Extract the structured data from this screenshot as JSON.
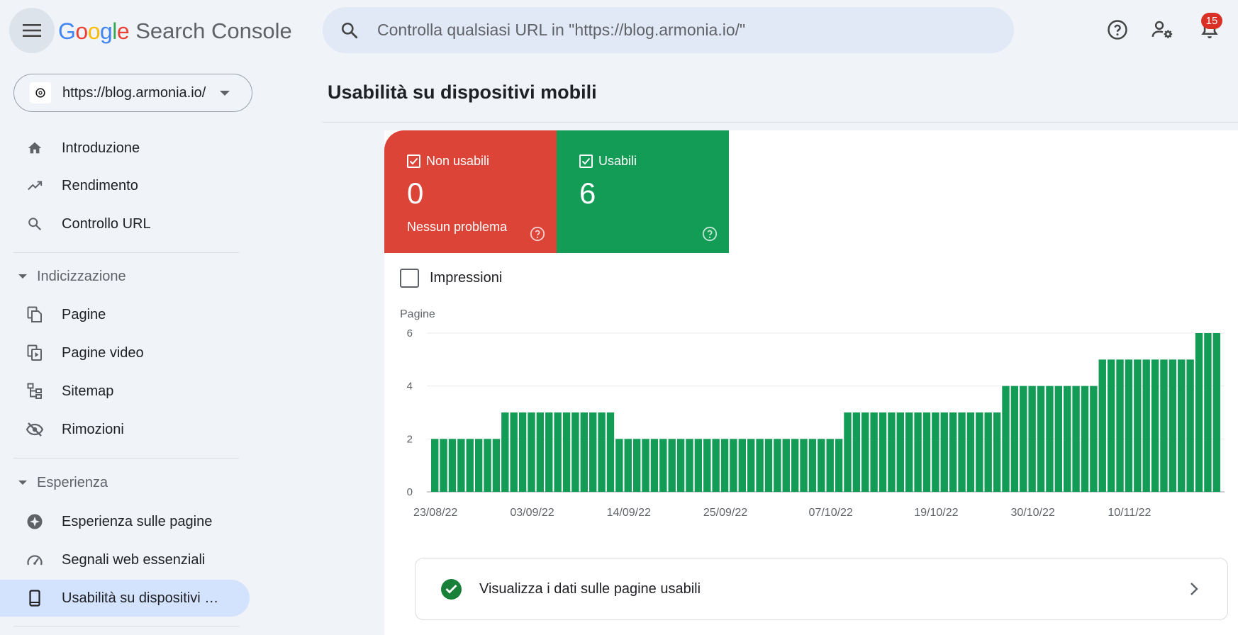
{
  "header": {
    "logo_letters": [
      {
        "ch": "G",
        "color": "#4285f4"
      },
      {
        "ch": "o",
        "color": "#ea4335"
      },
      {
        "ch": "o",
        "color": "#fbbc05"
      },
      {
        "ch": "g",
        "color": "#4285f4"
      },
      {
        "ch": "l",
        "color": "#34a853"
      },
      {
        "ch": "e",
        "color": "#ea4335"
      }
    ],
    "product": "Search Console",
    "search_placeholder": "Controlla qualsiasi URL in \"https://blog.armonia.io/\"",
    "notification_count": "15"
  },
  "sidebar": {
    "property": "https://blog.armonia.io/",
    "items_top": [
      {
        "label": "Introduzione",
        "icon": "home-icon"
      },
      {
        "label": "Rendimento",
        "icon": "trending-up-icon"
      },
      {
        "label": "Controllo URL",
        "icon": "search-icon"
      }
    ],
    "section_indexing": "Indicizzazione",
    "items_indexing": [
      {
        "label": "Pagine",
        "icon": "pages-icon"
      },
      {
        "label": "Pagine video",
        "icon": "video-pages-icon"
      },
      {
        "label": "Sitemap",
        "icon": "sitemap-icon"
      },
      {
        "label": "Rimozioni",
        "icon": "removals-icon"
      }
    ],
    "section_experience": "Esperienza",
    "items_experience": [
      {
        "label": "Esperienza sulle pagine",
        "icon": "page-experience-icon"
      },
      {
        "label": "Segnali web essenziali",
        "icon": "gauge-icon"
      },
      {
        "label": "Usabilità su dispositivi …",
        "icon": "phone-icon",
        "active": true
      }
    ]
  },
  "main": {
    "title": "Usabilità su dispositivi mobili",
    "cards": {
      "not_usable": {
        "label": "Non usabili",
        "value": "0",
        "sub": "Nessun problema",
        "color": "#dc4437"
      },
      "usable": {
        "label": "Usabili",
        "value": "6",
        "color": "#129c56"
      }
    },
    "impressions_label": "Impressioni",
    "link_card_label": "Visualizza i dati sulle pagine usabili"
  },
  "chart_data": {
    "type": "bar",
    "ylabel": "Pagine",
    "yticks": [
      0,
      2,
      4,
      6
    ],
    "ylim": [
      0,
      6
    ],
    "bar_color": "#129c56",
    "x_start": "23/08/22",
    "x_tick_labels": [
      "23/08/22",
      "03/09/22",
      "14/09/22",
      "25/09/22",
      "07/10/22",
      "19/10/22",
      "30/10/22",
      "10/11/22"
    ],
    "x_tick_indices": [
      0,
      11,
      22,
      33,
      45,
      57,
      68,
      79
    ],
    "values": [
      2,
      2,
      2,
      2,
      2,
      2,
      2,
      2,
      3,
      3,
      3,
      3,
      3,
      3,
      3,
      3,
      3,
      3,
      3,
      3,
      3,
      2,
      2,
      2,
      2,
      2,
      2,
      2,
      2,
      2,
      2,
      2,
      2,
      2,
      2,
      2,
      2,
      2,
      2,
      2,
      2,
      2,
      2,
      2,
      2,
      2,
      2,
      3,
      3,
      3,
      3,
      3,
      3,
      3,
      3,
      3,
      3,
      3,
      3,
      3,
      3,
      3,
      3,
      3,
      3,
      4,
      4,
      4,
      4,
      4,
      4,
      4,
      4,
      4,
      4,
      4,
      5,
      5,
      5,
      5,
      5,
      5,
      5,
      5,
      5,
      5,
      5,
      6,
      6,
      6
    ]
  }
}
